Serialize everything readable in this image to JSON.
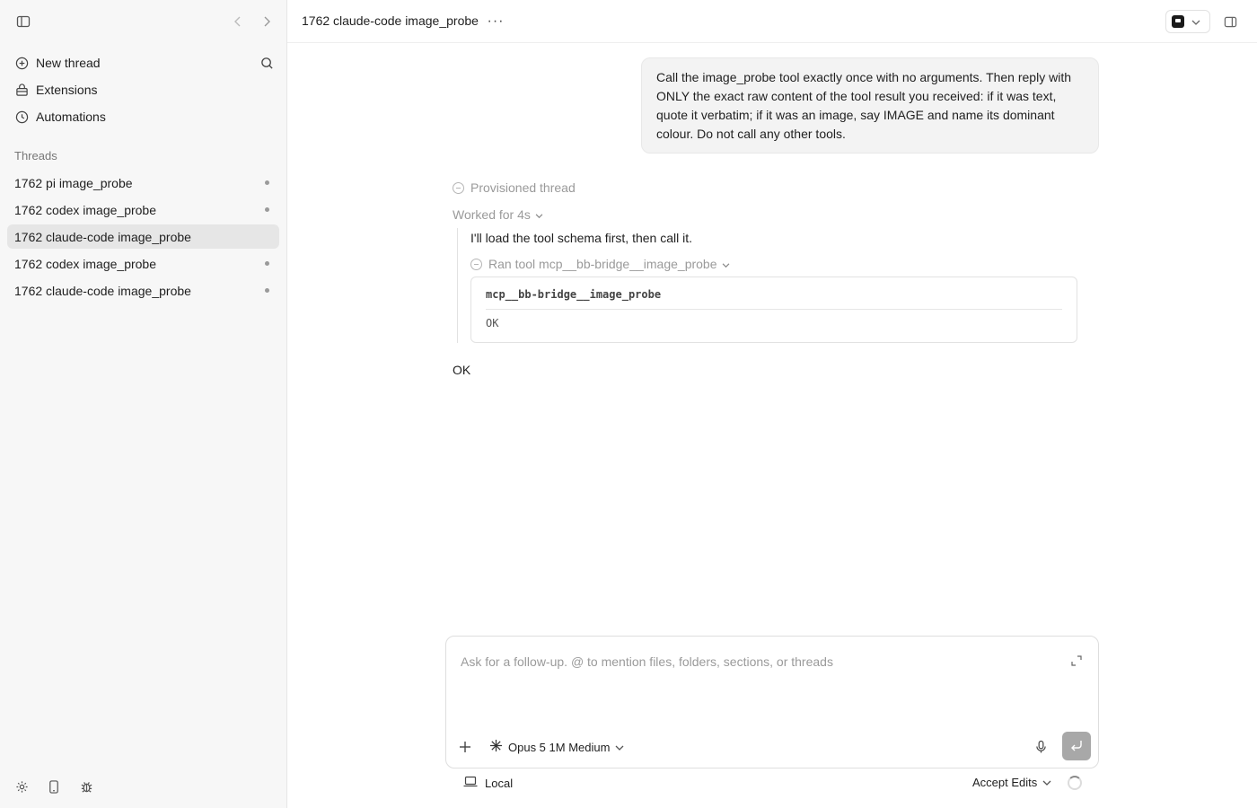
{
  "sidebar": {
    "nav": [
      {
        "label": "New thread",
        "icon": "plus-circle-icon"
      },
      {
        "label": "Extensions",
        "icon": "extensions-icon"
      },
      {
        "label": "Automations",
        "icon": "clock-icon"
      }
    ],
    "threads_label": "Threads",
    "threads": [
      {
        "title": "1762 pi image_probe",
        "active": false,
        "unread": true
      },
      {
        "title": "1762 codex image_probe",
        "active": false,
        "unread": true
      },
      {
        "title": "1762 claude-code image_probe",
        "active": true,
        "unread": false
      },
      {
        "title": "1762 codex image_probe",
        "active": false,
        "unread": true
      },
      {
        "title": "1762 claude-code image_probe",
        "active": false,
        "unread": true
      }
    ],
    "bottom_icons": [
      "gear-icon",
      "phone-icon",
      "bug-icon"
    ]
  },
  "header": {
    "title": "1762 claude-code image_probe",
    "more": "···"
  },
  "conversation": {
    "user_message": "Call the image_probe tool exactly once with no arguments. Then reply with ONLY the exact raw content of the tool result you received: if it was text, quote it verbatim; if it was an image, say IMAGE and name its dominant colour. Do not call any other tools.",
    "provisioned": "Provisioned thread",
    "worked_for": "Worked for 4s",
    "assistant_intro": "I'll load the tool schema first, then call it.",
    "tool_run_label": "Ran tool mcp__bb-bridge__image_probe",
    "tool_name": "mcp__bb-bridge__image_probe",
    "tool_result": "OK",
    "final_reply": "OK"
  },
  "composer": {
    "placeholder": "Ask for a follow-up. @ to mention files, folders, sections, or threads",
    "value": "",
    "model": "Opus 5 1M Medium"
  },
  "footer": {
    "environment": "Local",
    "mode": "Accept Edits"
  },
  "colors": {
    "sidebar_bg": "#f7f7f7",
    "active_thread_bg": "#e6e6e6",
    "bubble_bg": "#f3f3f3",
    "send_button": "#a8a8a8"
  }
}
